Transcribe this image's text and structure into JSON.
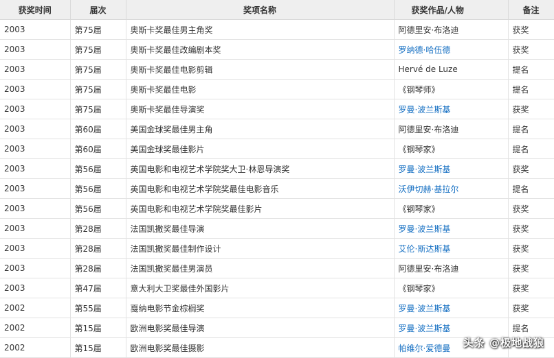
{
  "header": {
    "year": "获奖时间",
    "session": "届次",
    "award": "奖项名称",
    "winner": "获奖作品/人物",
    "note": "备注"
  },
  "rows": [
    {
      "year": "2003",
      "session": "第75届",
      "award": "奥斯卡奖最佳男主角奖",
      "winner": "阿德里安·布洛迪",
      "note": "获奖",
      "link": false
    },
    {
      "year": "2003",
      "session": "第75届",
      "award": "奥斯卡奖最佳改编剧本奖",
      "winner": "罗纳德·哈伍德",
      "note": "获奖",
      "link": true
    },
    {
      "year": "2003",
      "session": "第75届",
      "award": "奥斯卡奖最佳电影剪辑",
      "winner": "Hervé de Luze",
      "note": "提名",
      "link": false
    },
    {
      "year": "2003",
      "session": "第75届",
      "award": "奥斯卡奖最佳电影",
      "winner": "《钢琴师》",
      "note": "提名",
      "link": false
    },
    {
      "year": "2003",
      "session": "第75届",
      "award": "奥斯卡奖最佳导演奖",
      "winner": "罗曼·波兰斯基",
      "note": "获奖",
      "link": true
    },
    {
      "year": "2003",
      "session": "第60届",
      "award": "美国金球奖最佳男主角",
      "winner": "阿德里安·布洛迪",
      "note": "提名",
      "link": false
    },
    {
      "year": "2003",
      "session": "第60届",
      "award": "美国金球奖最佳影片",
      "winner": "《钢琴家》",
      "note": "提名",
      "link": false
    },
    {
      "year": "2003",
      "session": "第56届",
      "award": "英国电影和电视艺术学院奖大卫·林恩导演奖",
      "winner": "罗曼·波兰斯基",
      "note": "获奖",
      "link": true
    },
    {
      "year": "2003",
      "session": "第56届",
      "award": "英国电影和电视艺术学院奖最佳电影音乐",
      "winner": "沃伊切赫·基拉尔",
      "note": "提名",
      "link": true
    },
    {
      "year": "2003",
      "session": "第56届",
      "award": "英国电影和电视艺术学院奖最佳影片",
      "winner": "《钢琴家》",
      "note": "获奖",
      "link": false
    },
    {
      "year": "2003",
      "session": "第28届",
      "award": "法国凯撒奖最佳导演",
      "winner": "罗曼·波兰斯基",
      "note": "获奖",
      "link": true
    },
    {
      "year": "2003",
      "session": "第28届",
      "award": "法国凯撒奖最佳制作设计",
      "winner": "艾伦·斯达斯基",
      "note": "获奖",
      "link": true
    },
    {
      "year": "2003",
      "session": "第28届",
      "award": "法国凯撒奖最佳男演员",
      "winner": "阿德里安·布洛迪",
      "note": "获奖",
      "link": false
    },
    {
      "year": "2003",
      "session": "第47届",
      "award": "意大利大卫奖最佳外国影片",
      "winner": "《钢琴家》",
      "note": "获奖",
      "link": false
    },
    {
      "year": "2002",
      "session": "第55届",
      "award": "戛纳电影节金棕榈奖",
      "winner": "罗曼·波兰斯基",
      "note": "获奖",
      "link": true
    },
    {
      "year": "2002",
      "session": "第15届",
      "award": "欧洲电影奖最佳导演",
      "winner": "罗曼·波兰斯基",
      "note": "提名",
      "link": true
    },
    {
      "year": "2002",
      "session": "第15届",
      "award": "欧洲电影奖最佳摄影",
      "winner": "帕维尔·爱德曼",
      "note": "",
      "link": true
    }
  ],
  "watermark": "头条 @极地战狼"
}
